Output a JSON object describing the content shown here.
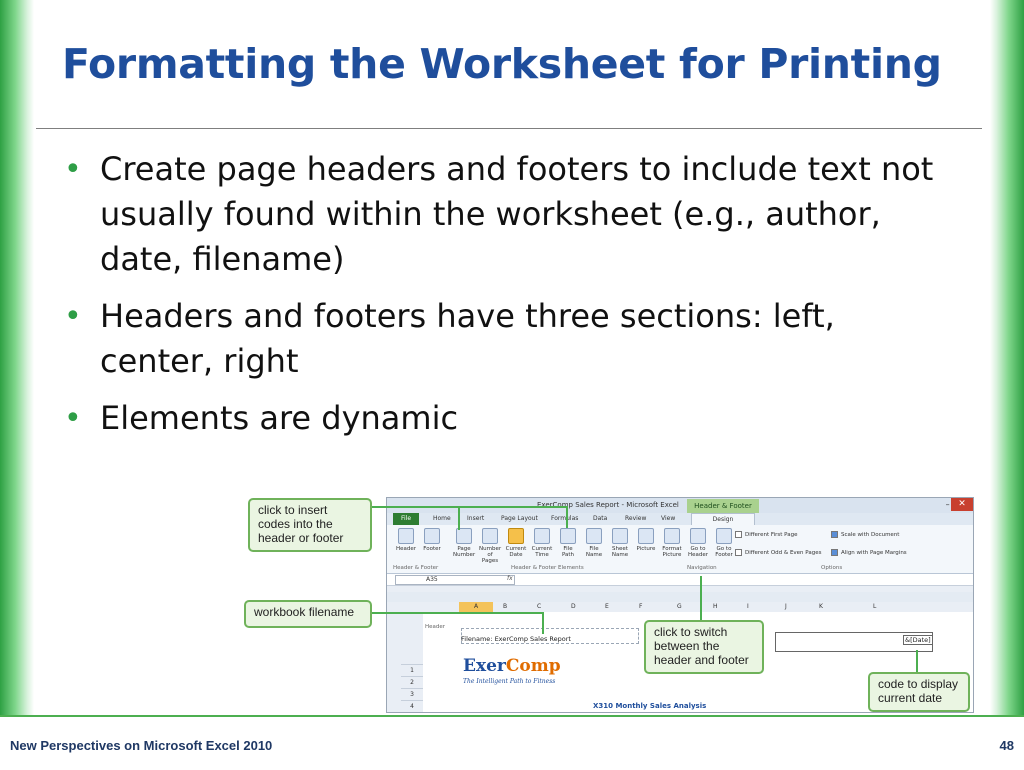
{
  "slide": {
    "title": "Formatting the Worksheet for Printing",
    "bullets": [
      "Create page headers and footers to include text not usually found within the worksheet (e.g., author, date, filename)",
      "Headers and footers have three sections: left, center, right",
      "Elements are dynamic"
    ],
    "footer_left": "New Perspectives on Microsoft Excel 2010",
    "page_number": "48"
  },
  "excel": {
    "window_title": "ExerComp Sales Report - Microsoft Excel",
    "context_tab": "Header & Footer Tools",
    "tabs": [
      "File",
      "Home",
      "Insert",
      "Page Layout",
      "Formulas",
      "Data",
      "Review",
      "View",
      "Design"
    ],
    "ribbon_buttons": [
      {
        "label": "Header",
        "icon": "header-icon"
      },
      {
        "label": "Footer",
        "icon": "footer-icon"
      },
      {
        "label": "Page Number",
        "icon": "page-number-icon"
      },
      {
        "label": "Number of Pages",
        "icon": "number-of-pages-icon"
      },
      {
        "label": "Current Date",
        "icon": "current-date-icon"
      },
      {
        "label": "Current Time",
        "icon": "clock-icon"
      },
      {
        "label": "File Path",
        "icon": "folder-icon"
      },
      {
        "label": "File Name",
        "icon": "file-icon"
      },
      {
        "label": "Sheet Name",
        "icon": "sheet-icon"
      },
      {
        "label": "Picture",
        "icon": "picture-icon"
      },
      {
        "label": "Format Picture",
        "icon": "format-picture-icon"
      },
      {
        "label": "Go to Header",
        "icon": "go-to-header-icon"
      },
      {
        "label": "Go to Footer",
        "icon": "go-to-footer-icon"
      }
    ],
    "groups": [
      "Header & Footer",
      "Header & Footer Elements",
      "Navigation",
      "Options"
    ],
    "options": [
      {
        "label": "Different First Page",
        "checked": false
      },
      {
        "label": "Different Odd & Even Pages",
        "checked": false
      },
      {
        "label": "Scale with Document",
        "checked": true
      },
      {
        "label": "Align with Page Margins",
        "checked": true
      }
    ],
    "name_box": "A35",
    "fx_symbol": "fx",
    "columns": [
      "A",
      "B",
      "C",
      "D",
      "E",
      "F",
      "G",
      "H",
      "I",
      "J",
      "K",
      "L"
    ],
    "header_label": "Header",
    "header_left_text": "Filename: ExerComp Sales Report",
    "header_right_code": "&[Date]",
    "rows": [
      "1",
      "2",
      "3",
      "4"
    ],
    "logo_part1": "Exer",
    "logo_part2": "Comp",
    "logo_tagline": "The Intelligent Path to Fitness",
    "sheet_title": "X310 Monthly Sales Analysis"
  },
  "callouts": {
    "insert_codes": "click to insert codes into the header or footer",
    "workbook_filename": "workbook filename",
    "switch": "click to switch between the header and footer",
    "display_date": "code to display current date"
  },
  "colors": {
    "title": "#1f4e9c",
    "bullet": "#2e9e46",
    "accent_green": "#4caf50",
    "callout_fill": "#eaf5e2",
    "footer_text": "#1f3864"
  }
}
